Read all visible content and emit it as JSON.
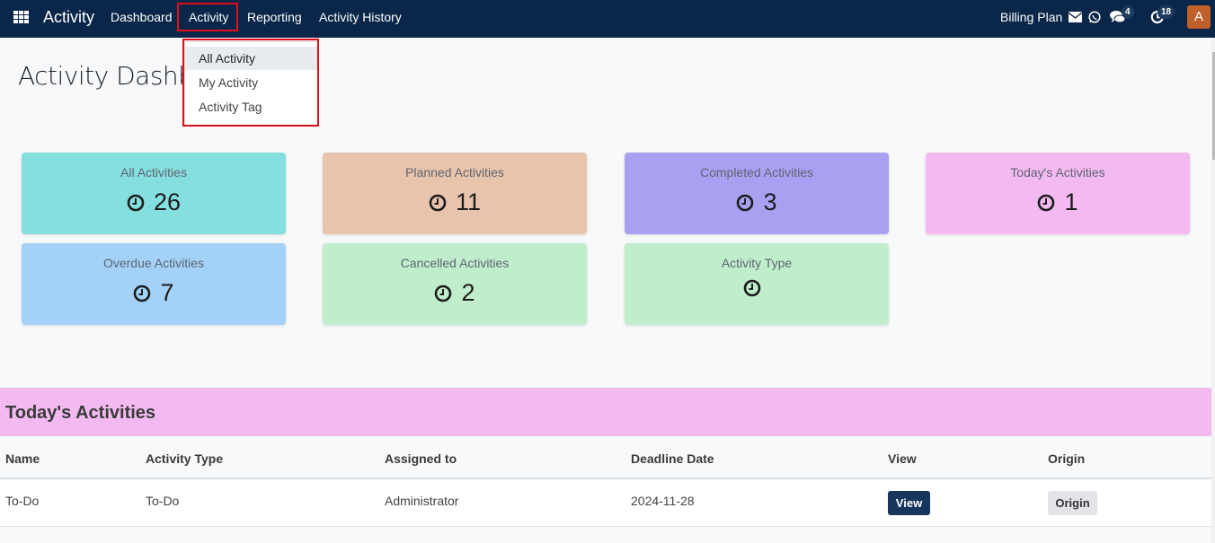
{
  "navbar": {
    "app_title": "Activity",
    "menu": [
      "Dashboard",
      "Activity",
      "Reporting",
      "Activity History"
    ],
    "active_menu": "Activity",
    "company": "Billing Plan",
    "messages_badge": "4",
    "activities_badge": "18",
    "avatar_initial": "A"
  },
  "dropdown": {
    "items": [
      "All Activity",
      "My Activity",
      "Activity Tag"
    ],
    "highlighted": "All Activity"
  },
  "page": {
    "title": "Activity Dashboard"
  },
  "cards": [
    {
      "title": "All Activities",
      "value": "26",
      "color": "#86dfdf"
    },
    {
      "title": "Planned Activities",
      "value": "11",
      "color": "#e8c4ac"
    },
    {
      "title": "Completed Activities",
      "value": "3",
      "color": "#a8a1f2"
    },
    {
      "title": "Today's Activities",
      "value": "1",
      "color": "#f3baf1"
    },
    {
      "title": "Overdue Activities",
      "value": "7",
      "color": "#a3d1f8"
    },
    {
      "title": "Cancelled Activities",
      "value": "2",
      "color": "#c0eecd"
    },
    {
      "title": "Activity Type",
      "value": "",
      "color": "#c0eecd"
    }
  ],
  "today_section": {
    "title": "Today's Activities",
    "columns": [
      "Name",
      "Activity Type",
      "Assigned to",
      "Deadline Date",
      "View",
      "Origin"
    ],
    "rows": [
      {
        "name": "To-Do",
        "activity_type": "To-Do",
        "assigned_to": "Administrator",
        "deadline": "2024-11-28",
        "view_label": "View",
        "origin_label": "Origin"
      }
    ]
  }
}
